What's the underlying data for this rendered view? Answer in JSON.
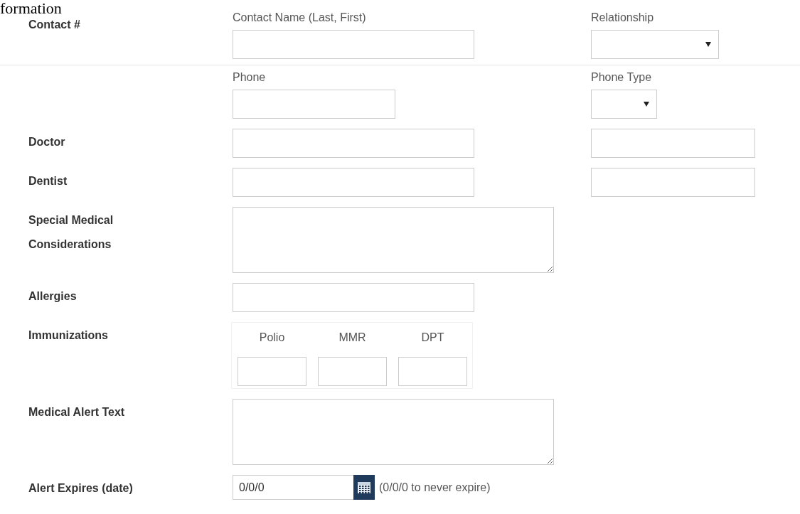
{
  "heading": "formation",
  "rows": [
    {
      "label": "Contact #",
      "divider": true,
      "fields": [
        {
          "kind": "text",
          "label": "Contact Name (Last, First)"
        },
        {
          "kind": "select",
          "label": "Relationship"
        }
      ]
    },
    {
      "label": "",
      "fields": [
        {
          "kind": "short-text",
          "label": "Phone"
        },
        {
          "kind": "small-select",
          "label": "Phone Type"
        }
      ]
    },
    {
      "label": "Doctor",
      "fields": [
        {
          "kind": "text"
        },
        {
          "kind": "side-text"
        }
      ]
    },
    {
      "label": "Dentist",
      "fields": [
        {
          "kind": "text"
        },
        {
          "kind": "side-text"
        }
      ]
    },
    {
      "label": "Special Medical Considerations",
      "fields": [
        {
          "kind": "textarea"
        }
      ]
    },
    {
      "label": "Allergies",
      "fields": [
        {
          "kind": "text"
        }
      ]
    },
    {
      "label": "Immunizations",
      "fields": [
        {
          "kind": "grid",
          "columns": [
            "Polio",
            "MMR",
            "DPT"
          ]
        }
      ]
    },
    {
      "label": "Medical Alert Text",
      "fields": [
        {
          "kind": "textarea"
        }
      ]
    },
    {
      "label": "Alert Expires (date)",
      "fields": [
        {
          "kind": "date",
          "value": "0/0/0",
          "hint": "(0/0/0 to never expire)"
        }
      ]
    }
  ]
}
